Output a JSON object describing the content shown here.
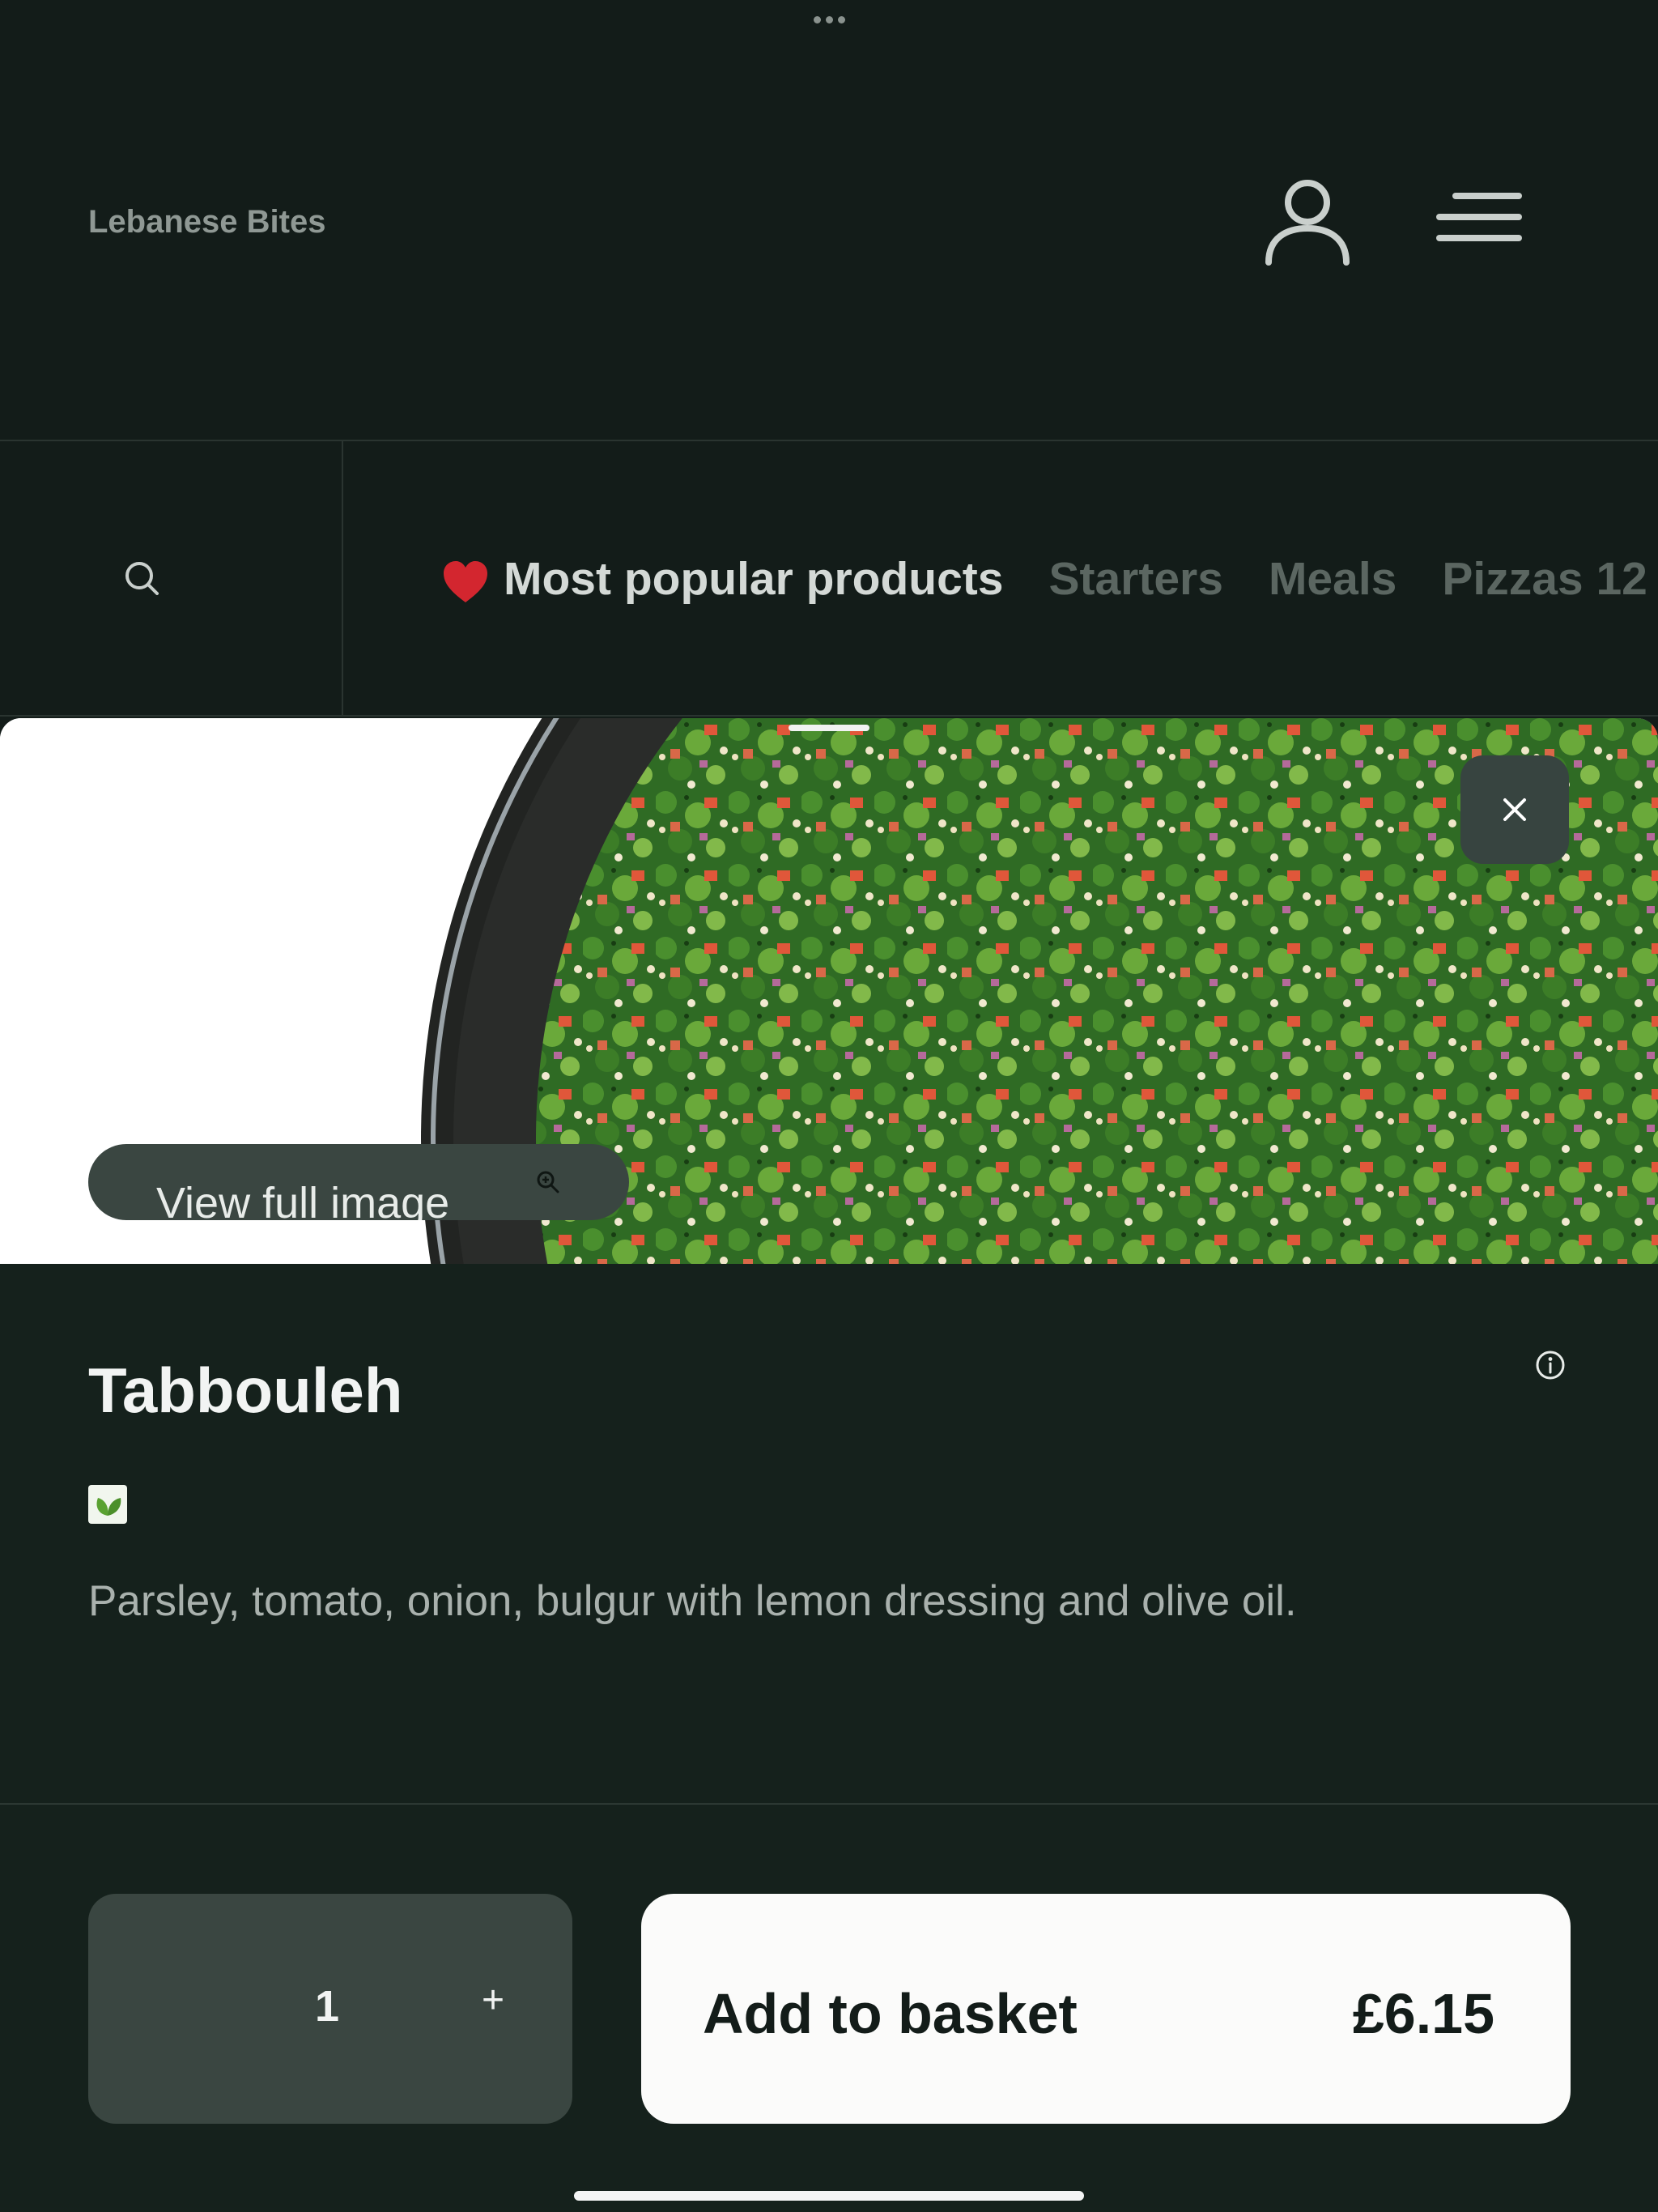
{
  "header": {
    "brand": "Lebanese Bites",
    "account_icon": "user-icon",
    "menu_icon": "hamburger-menu-icon"
  },
  "categories": {
    "search_icon": "search-icon",
    "tabs": [
      {
        "label": "Most popular products",
        "emoji": "heart-icon",
        "active": true
      },
      {
        "label": "Starters",
        "active": false
      },
      {
        "label": "Meals",
        "active": false
      },
      {
        "label": "Pizzas 12",
        "active": false
      }
    ]
  },
  "product": {
    "image_button_label": "View full image",
    "title": "Tabbouleh",
    "dietary_badge": "vegetarian-leaf-icon",
    "description": "Parsley, tomato, onion, bulgur with lemon dressing and olive oil.",
    "quantity": "1",
    "plus_label": "+",
    "add_label": "Add to basket",
    "price": "£6.15"
  },
  "colors": {
    "background": "#131c19",
    "sheet": "#15211c",
    "pill": "#3a4641",
    "primary_button": "#fbfbfa"
  }
}
